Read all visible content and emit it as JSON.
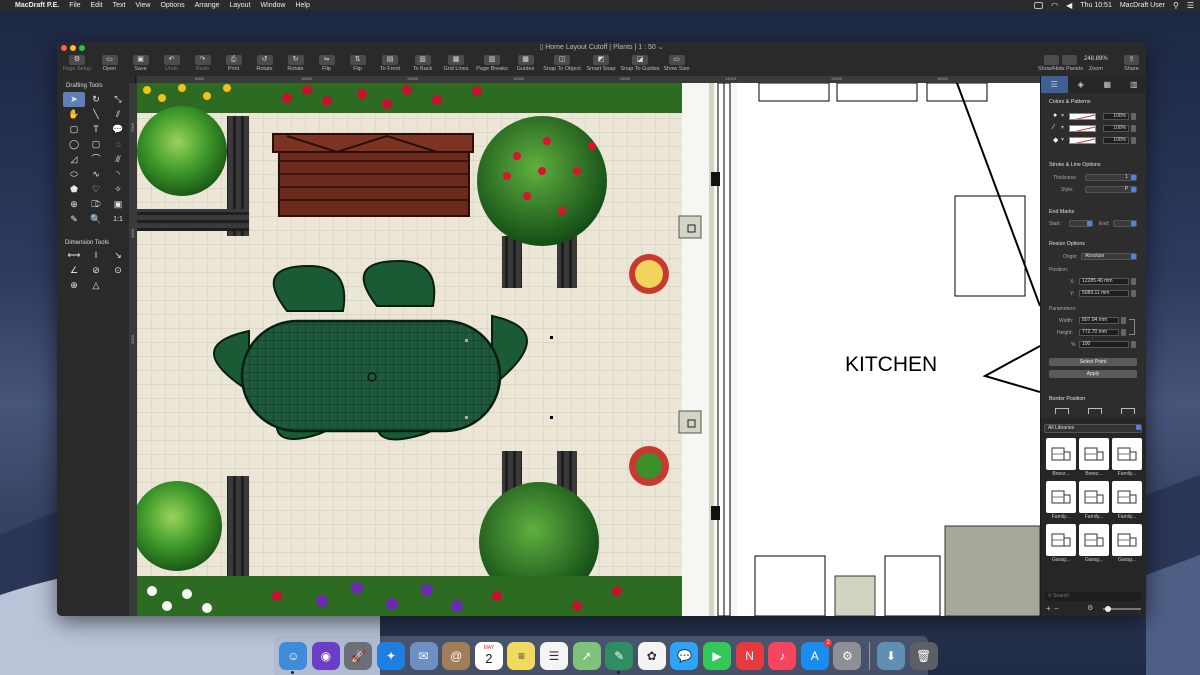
{
  "menubar": {
    "apple": "",
    "app_name": "MacDraft P.E.",
    "menus": [
      "File",
      "Edit",
      "Text",
      "View",
      "Options",
      "Arrange",
      "Layout",
      "Window",
      "Help"
    ],
    "clock": "Thu 10:51",
    "user": "MacDraft User"
  },
  "window": {
    "title": "Home Layout Cutoff | Plants | 1 : 50"
  },
  "toolbar": {
    "items": [
      {
        "label": "Page Setup",
        "icon": "gear-icon",
        "enabled": false
      },
      {
        "label": "Open",
        "icon": "folder-icon",
        "enabled": true
      },
      {
        "label": "Save",
        "icon": "save-icon",
        "enabled": true
      },
      {
        "label": "Undo",
        "icon": "undo-icon",
        "enabled": false
      },
      {
        "label": "Redo",
        "icon": "redo-icon",
        "enabled": false
      },
      {
        "label": "Print",
        "icon": "printer-icon",
        "enabled": true
      },
      {
        "label": "Rotate",
        "icon": "rotate-left-icon",
        "enabled": true
      },
      {
        "label": "Rotate",
        "icon": "rotate-right-icon",
        "enabled": true
      },
      {
        "label": "Flip",
        "icon": "flip-horizontal-icon",
        "enabled": true
      },
      {
        "label": "Flip",
        "icon": "flip-vertical-icon",
        "enabled": true
      },
      {
        "label": "To Front",
        "icon": "to-front-icon",
        "enabled": true
      },
      {
        "label": "To Back",
        "icon": "to-back-icon",
        "enabled": true
      },
      {
        "label": "Grid Lines",
        "icon": "grid-lines-icon",
        "enabled": true
      },
      {
        "label": "Page Breaks",
        "icon": "page-breaks-icon",
        "enabled": true
      },
      {
        "label": "Guides",
        "icon": "guides-icon",
        "enabled": true
      },
      {
        "label": "Snap To Object",
        "icon": "snap-object-icon",
        "enabled": true
      },
      {
        "label": "Smart Snap",
        "icon": "smart-snap-icon",
        "enabled": true
      },
      {
        "label": "Snap To Guides",
        "icon": "snap-guides-icon",
        "enabled": true
      },
      {
        "label": "Show Size",
        "icon": "show-size-icon",
        "enabled": true
      }
    ],
    "show_hide_label": "Show/Hide Panels",
    "zoom_value": "248.89%",
    "zoom_label": "Zoom",
    "share_label": "Share"
  },
  "drafting_tools": {
    "title": "Drafting Tools",
    "tools": [
      {
        "name": "pointer-tool",
        "glyph": "➤",
        "selected": true
      },
      {
        "name": "rotate-tool",
        "glyph": "↻"
      },
      {
        "name": "reshape-tool",
        "glyph": "⤡"
      },
      {
        "name": "hand-tool",
        "glyph": "✋"
      },
      {
        "name": "line-tool",
        "glyph": "╲"
      },
      {
        "name": "parallel-line-tool",
        "glyph": "⫽"
      },
      {
        "name": "rectangle-tool",
        "glyph": "▢"
      },
      {
        "name": "text-tool",
        "glyph": "T"
      },
      {
        "name": "callout-tool",
        "glyph": "💬"
      },
      {
        "name": "circle-tool",
        "glyph": "◯"
      },
      {
        "name": "rounded-rect-tool",
        "glyph": "▢"
      },
      {
        "name": "bezier-tool",
        "glyph": "◌"
      },
      {
        "name": "polygon-tool",
        "glyph": "◿"
      },
      {
        "name": "curve-tool",
        "glyph": "⌒"
      },
      {
        "name": "double-line-tool",
        "glyph": "⫻"
      },
      {
        "name": "ellipse-tool",
        "glyph": "⬭"
      },
      {
        "name": "spline-tool",
        "glyph": "∿"
      },
      {
        "name": "arc-tool",
        "glyph": "◝"
      },
      {
        "name": "fill-tool",
        "glyph": "⬟"
      },
      {
        "name": "heart-tool",
        "glyph": "♡"
      },
      {
        "name": "star-tool",
        "glyph": "✧"
      },
      {
        "name": "anchor-tool",
        "glyph": "⊕"
      },
      {
        "name": "symbol-tool",
        "glyph": "⎄"
      },
      {
        "name": "image-tool",
        "glyph": "▣"
      },
      {
        "name": "eyedropper-tool",
        "glyph": "✎"
      },
      {
        "name": "zoom-tool",
        "glyph": "🔍"
      },
      {
        "name": "scale-tool",
        "glyph": "1:1"
      }
    ]
  },
  "dimension_tools": {
    "title": "Dimension Tools",
    "tools": [
      {
        "name": "horizontal-dimension-tool",
        "glyph": "⟷"
      },
      {
        "name": "vertical-dimension-tool",
        "glyph": "I"
      },
      {
        "name": "slope-dimension-tool",
        "glyph": "↘"
      },
      {
        "name": "angle-dimension-tool",
        "glyph": "∠"
      },
      {
        "name": "diameter-dimension-tool",
        "glyph": "⊘"
      },
      {
        "name": "radius-dimension-tool",
        "glyph": "⊙"
      },
      {
        "name": "center-mark-tool",
        "glyph": "⊕"
      },
      {
        "name": "area-tool",
        "glyph": "△"
      }
    ]
  },
  "rulers": {
    "top": [
      "9000",
      "10000",
      "11000",
      "12000",
      "13000",
      "14000",
      "15000",
      "16000"
    ],
    "left": [
      "5000",
      "4000",
      "3000"
    ]
  },
  "drawing": {
    "room_label": "KITCHEN"
  },
  "inspector": {
    "colors_title": "Colors & Patterns",
    "color_rows": [
      {
        "icon": "fill-drop-icon",
        "value": "100%"
      },
      {
        "icon": "pen-line-icon",
        "value": "100%"
      },
      {
        "icon": "fill-bucket-icon",
        "value": "100%"
      }
    ],
    "stroke_title": "Stroke & Line Options",
    "thickness_label": "Thickness:",
    "thickness_value": "1",
    "style_label": "Style:",
    "style_value": "P",
    "endmarks_title": "End Marks",
    "start_label": "Start:",
    "end_label": "End:",
    "resize_title": "Resize Options",
    "origin_label": "Origin:",
    "origin_value": "Absolute",
    "position_label": "Position:",
    "x_label": "X:",
    "x_value": "12285.46 mm",
    "y_label": "Y:",
    "y_value": "5089.11 mm",
    "parameters_label": "Parameters:",
    "width_label": "Width:",
    "width_value": "807.04 mm",
    "height_label": "Height:",
    "height_value": "772.70 mm",
    "percent_label": "%",
    "percent_value": "100",
    "select_point_label": "Select Point",
    "apply_label": "Apply",
    "border_title": "Border Position"
  },
  "library": {
    "selector": "All Libraries",
    "items": [
      "Breez...",
      "Breez...",
      "Family...",
      "Family...",
      "Family...",
      "Family...",
      "Garag...",
      "Garag...",
      "Garag..."
    ],
    "search_placeholder": "Search"
  },
  "dock": {
    "apps": [
      {
        "name": "finder",
        "color": "#3d8bd9",
        "glyph": "☺"
      },
      {
        "name": "siri",
        "color": "#6a3ec6",
        "glyph": "◉"
      },
      {
        "name": "launchpad",
        "color": "#6b6f78",
        "glyph": "🚀"
      },
      {
        "name": "safari",
        "color": "#1f7fe0",
        "glyph": "✦"
      },
      {
        "name": "mail-stamp",
        "color": "#6d8fc4",
        "glyph": "✉"
      },
      {
        "name": "contacts",
        "color": "#a17e57",
        "glyph": "@"
      },
      {
        "name": "calendar",
        "color": "#ffffff",
        "glyph": "2"
      },
      {
        "name": "notes",
        "color": "#f2d95f",
        "glyph": "≡"
      },
      {
        "name": "reminders",
        "color": "#f4f4f4",
        "glyph": "☰"
      },
      {
        "name": "maps",
        "color": "#7fc27a",
        "glyph": "➚"
      },
      {
        "name": "macdraft",
        "color": "#2f8d61",
        "glyph": "✎"
      },
      {
        "name": "photos",
        "color": "#f4f4f4",
        "glyph": "✿"
      },
      {
        "name": "messages",
        "color": "#2da4f5",
        "glyph": "💬"
      },
      {
        "name": "facetime",
        "color": "#34c759",
        "glyph": "▶"
      },
      {
        "name": "news",
        "color": "#e73a3f",
        "glyph": "N"
      },
      {
        "name": "music",
        "color": "#f8455f",
        "glyph": "♪"
      },
      {
        "name": "app-store",
        "color": "#1a8cf0",
        "glyph": "A"
      },
      {
        "name": "system-preferences",
        "color": "#8d8f94",
        "glyph": "⚙"
      },
      {
        "name": "downloads",
        "color": "#5f8fb2",
        "glyph": "⬇"
      },
      {
        "name": "trash",
        "color": "#5b5f66",
        "glyph": "🗑"
      }
    ],
    "calendar_month": "MAY",
    "calendar_day": "2",
    "app_store_badge": "2"
  }
}
